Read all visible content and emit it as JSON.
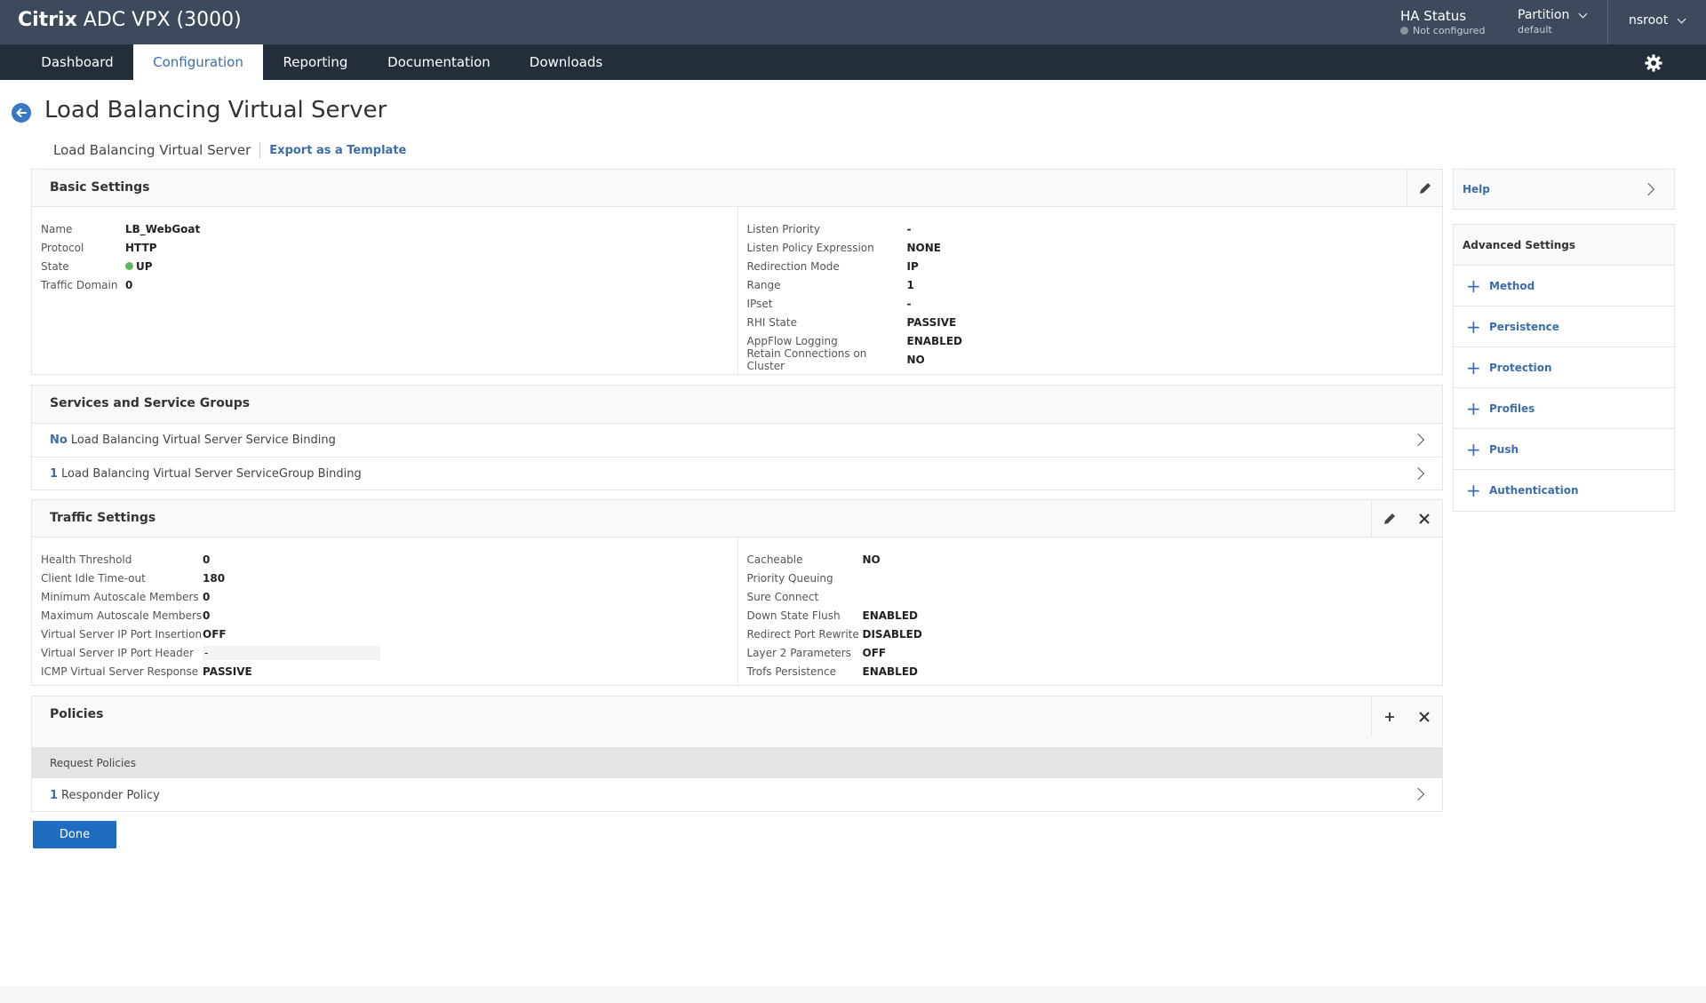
{
  "header": {
    "brand_bold": "Citrix",
    "brand_rest": " ADC VPX (3000)",
    "ha_status_label": "HA Status",
    "ha_status_value": "Not configured",
    "partition_label": "Partition",
    "partition_value": "default",
    "user": "nsroot"
  },
  "nav": {
    "tabs": [
      "Dashboard",
      "Configuration",
      "Reporting",
      "Documentation",
      "Downloads"
    ],
    "active": "Configuration"
  },
  "page": {
    "title": "Load Balancing Virtual Server",
    "breadcrumb": "Load Balancing Virtual Server",
    "export_link": "Export as a Template"
  },
  "basic_settings": {
    "title": "Basic Settings",
    "left": [
      {
        "k": "Name",
        "v": "LB_WebGoat"
      },
      {
        "k": "Protocol",
        "v": "HTTP"
      },
      {
        "k": "State",
        "v": "UP"
      },
      {
        "k": "Traffic Domain",
        "v": "0"
      }
    ],
    "right": [
      {
        "k": "Listen Priority",
        "v": "-"
      },
      {
        "k": "Listen Policy Expression",
        "v": "NONE"
      },
      {
        "k": "Redirection Mode",
        "v": "IP"
      },
      {
        "k": "Range",
        "v": "1"
      },
      {
        "k": "IPset",
        "v": "-"
      },
      {
        "k": "RHI State",
        "v": "PASSIVE"
      },
      {
        "k": "AppFlow Logging",
        "v": "ENABLED"
      },
      {
        "k": "Retain Connections on Cluster",
        "v": "NO"
      }
    ]
  },
  "services": {
    "title": "Services and Service Groups",
    "rows": [
      {
        "num": "No",
        "label": "Load Balancing Virtual Server Service Binding"
      },
      {
        "num": "1",
        "label": "Load Balancing Virtual Server ServiceGroup Binding"
      }
    ]
  },
  "traffic_settings": {
    "title": "Traffic Settings",
    "left": [
      {
        "k": "Health Threshold",
        "v": "0"
      },
      {
        "k": "Client Idle Time-out",
        "v": "180"
      },
      {
        "k": "Minimum Autoscale Members",
        "v": "0"
      },
      {
        "k": "Maximum Autoscale Members",
        "v": "0"
      },
      {
        "k": "Virtual Server IP Port Insertion",
        "v": "OFF"
      },
      {
        "k": "Virtual Server IP Port Header",
        "v": "-"
      },
      {
        "k": "ICMP Virtual Server Response",
        "v": "PASSIVE"
      }
    ],
    "right": [
      {
        "k": "Cacheable",
        "v": "NO"
      },
      {
        "k": "Priority Queuing",
        "v": ""
      },
      {
        "k": "Sure Connect",
        "v": ""
      },
      {
        "k": "Down State Flush",
        "v": "ENABLED"
      },
      {
        "k": "Redirect Port Rewrite",
        "v": "DISABLED"
      },
      {
        "k": "Layer 2 Parameters",
        "v": "OFF"
      },
      {
        "k": "Trofs Persistence",
        "v": "ENABLED"
      }
    ]
  },
  "policies": {
    "title": "Policies",
    "subheader": "Request Policies",
    "row": {
      "num": "1",
      "label": "Responder Policy"
    }
  },
  "done_label": "Done",
  "sidebar": {
    "help": "Help",
    "advanced_title": "Advanced Settings",
    "items": [
      "Method",
      "Persistence",
      "Protection",
      "Profiles",
      "Push",
      "Authentication"
    ]
  },
  "colors": {
    "header_bg": "#3d4a5c",
    "nav_bg": "#242d3a",
    "accent": "#3b6ea8",
    "button": "#1f6dc0",
    "status_up": "#5cb85c"
  }
}
